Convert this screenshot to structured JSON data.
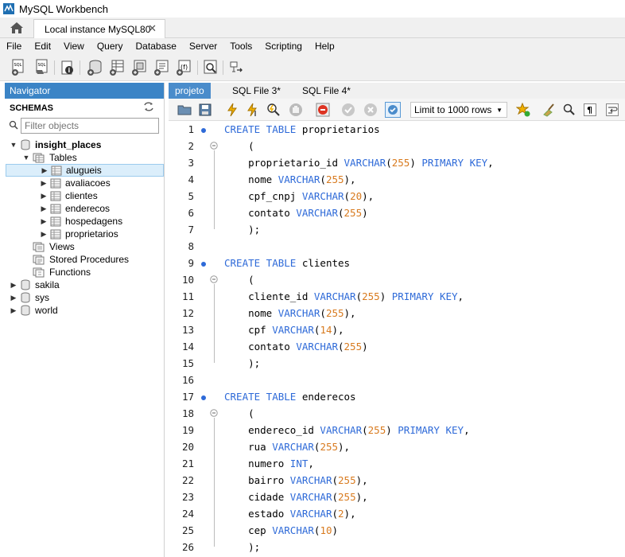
{
  "window": {
    "title": "MySQL Workbench"
  },
  "connection_tab": {
    "label": "Local instance MySQL80",
    "close": "✕"
  },
  "menu": [
    "File",
    "Edit",
    "View",
    "Query",
    "Database",
    "Server",
    "Tools",
    "Scripting",
    "Help"
  ],
  "navigator": {
    "header": "Navigator",
    "schemas_label": "SCHEMAS",
    "filter_placeholder": "Filter objects",
    "tree": [
      {
        "label": "insight_places",
        "bold": true
      },
      {
        "label": "Tables"
      },
      {
        "label": "alugueis",
        "selected": true
      },
      {
        "label": "avaliacoes"
      },
      {
        "label": "clientes"
      },
      {
        "label": "enderecos"
      },
      {
        "label": "hospedagens"
      },
      {
        "label": "proprietarios"
      },
      {
        "label": "Views"
      },
      {
        "label": "Stored Procedures"
      },
      {
        "label": "Functions"
      },
      {
        "label": "sakila"
      },
      {
        "label": "sys"
      },
      {
        "label": "world"
      }
    ]
  },
  "editor_tabs": [
    {
      "label": "projeto",
      "active": true
    },
    {
      "label": "SQL File 3*"
    },
    {
      "label": "SQL File 4*"
    }
  ],
  "editor_toolbar": {
    "limit_label": "Limit to 1000 rows"
  },
  "code": [
    {
      "n": "1",
      "parts": [
        [
          "kw",
          "CREATE TABLE"
        ],
        [
          "t",
          " proprietarios"
        ]
      ],
      "dot": true
    },
    {
      "n": "2",
      "parts": [
        [
          "t",
          "    ("
        ]
      ],
      "fold": true
    },
    {
      "n": "3",
      "parts": [
        [
          "t",
          "    proprietario_id "
        ],
        [
          "kw",
          "VARCHAR"
        ],
        [
          "t",
          "("
        ],
        [
          "num",
          "255"
        ],
        [
          "t",
          ") "
        ],
        [
          "kw",
          "PRIMARY KEY"
        ],
        [
          "t",
          ","
        ]
      ]
    },
    {
      "n": "4",
      "parts": [
        [
          "t",
          "    nome "
        ],
        [
          "kw",
          "VARCHAR"
        ],
        [
          "t",
          "("
        ],
        [
          "num",
          "255"
        ],
        [
          "t",
          "),"
        ]
      ]
    },
    {
      "n": "5",
      "parts": [
        [
          "t",
          "    cpf_cnpj "
        ],
        [
          "kw",
          "VARCHAR"
        ],
        [
          "t",
          "("
        ],
        [
          "num",
          "20"
        ],
        [
          "t",
          "),"
        ]
      ]
    },
    {
      "n": "6",
      "parts": [
        [
          "t",
          "    contato "
        ],
        [
          "kw",
          "VARCHAR"
        ],
        [
          "t",
          "("
        ],
        [
          "num",
          "255"
        ],
        [
          "t",
          ")"
        ]
      ]
    },
    {
      "n": "7",
      "parts": [
        [
          "t",
          "    );"
        ]
      ]
    },
    {
      "n": "8",
      "parts": []
    },
    {
      "n": "9",
      "parts": [
        [
          "kw",
          "CREATE TABLE"
        ],
        [
          "t",
          " clientes"
        ]
      ],
      "dot": true
    },
    {
      "n": "10",
      "parts": [
        [
          "t",
          "    ("
        ]
      ],
      "fold": true
    },
    {
      "n": "11",
      "parts": [
        [
          "t",
          "    cliente_id "
        ],
        [
          "kw",
          "VARCHAR"
        ],
        [
          "t",
          "("
        ],
        [
          "num",
          "255"
        ],
        [
          "t",
          ") "
        ],
        [
          "kw",
          "PRIMARY KEY"
        ],
        [
          "t",
          ","
        ]
      ]
    },
    {
      "n": "12",
      "parts": [
        [
          "t",
          "    nome "
        ],
        [
          "kw",
          "VARCHAR"
        ],
        [
          "t",
          "("
        ],
        [
          "num",
          "255"
        ],
        [
          "t",
          "),"
        ]
      ]
    },
    {
      "n": "13",
      "parts": [
        [
          "t",
          "    cpf "
        ],
        [
          "kw",
          "VARCHAR"
        ],
        [
          "t",
          "("
        ],
        [
          "num",
          "14"
        ],
        [
          "t",
          "),"
        ]
      ]
    },
    {
      "n": "14",
      "parts": [
        [
          "t",
          "    contato "
        ],
        [
          "kw",
          "VARCHAR"
        ],
        [
          "t",
          "("
        ],
        [
          "num",
          "255"
        ],
        [
          "t",
          ")"
        ]
      ]
    },
    {
      "n": "15",
      "parts": [
        [
          "t",
          "    );"
        ]
      ]
    },
    {
      "n": "16",
      "parts": []
    },
    {
      "n": "17",
      "parts": [
        [
          "kw",
          "CREATE TABLE"
        ],
        [
          "t",
          " enderecos"
        ]
      ],
      "dot": true
    },
    {
      "n": "18",
      "parts": [
        [
          "t",
          "    ("
        ]
      ],
      "fold": true
    },
    {
      "n": "19",
      "parts": [
        [
          "t",
          "    endereco_id "
        ],
        [
          "kw",
          "VARCHAR"
        ],
        [
          "t",
          "("
        ],
        [
          "num",
          "255"
        ],
        [
          "t",
          ") "
        ],
        [
          "kw",
          "PRIMARY KEY"
        ],
        [
          "t",
          ","
        ]
      ]
    },
    {
      "n": "20",
      "parts": [
        [
          "t",
          "    rua "
        ],
        [
          "kw",
          "VARCHAR"
        ],
        [
          "t",
          "("
        ],
        [
          "num",
          "255"
        ],
        [
          "t",
          "),"
        ]
      ]
    },
    {
      "n": "21",
      "parts": [
        [
          "t",
          "    numero "
        ],
        [
          "kw",
          "INT"
        ],
        [
          "t",
          ","
        ]
      ]
    },
    {
      "n": "22",
      "parts": [
        [
          "t",
          "    bairro "
        ],
        [
          "kw",
          "VARCHAR"
        ],
        [
          "t",
          "("
        ],
        [
          "num",
          "255"
        ],
        [
          "t",
          "),"
        ]
      ]
    },
    {
      "n": "23",
      "parts": [
        [
          "t",
          "    cidade "
        ],
        [
          "kw",
          "VARCHAR"
        ],
        [
          "t",
          "("
        ],
        [
          "num",
          "255"
        ],
        [
          "t",
          "),"
        ]
      ]
    },
    {
      "n": "24",
      "parts": [
        [
          "t",
          "    estado "
        ],
        [
          "kw",
          "VARCHAR"
        ],
        [
          "t",
          "("
        ],
        [
          "num",
          "2"
        ],
        [
          "t",
          "),"
        ]
      ]
    },
    {
      "n": "25",
      "parts": [
        [
          "t",
          "    cep "
        ],
        [
          "kw",
          "VARCHAR"
        ],
        [
          "t",
          "("
        ],
        [
          "num",
          "10"
        ],
        [
          "t",
          ")"
        ]
      ]
    },
    {
      "n": "26",
      "parts": [
        [
          "t",
          "    );"
        ]
      ]
    }
  ]
}
